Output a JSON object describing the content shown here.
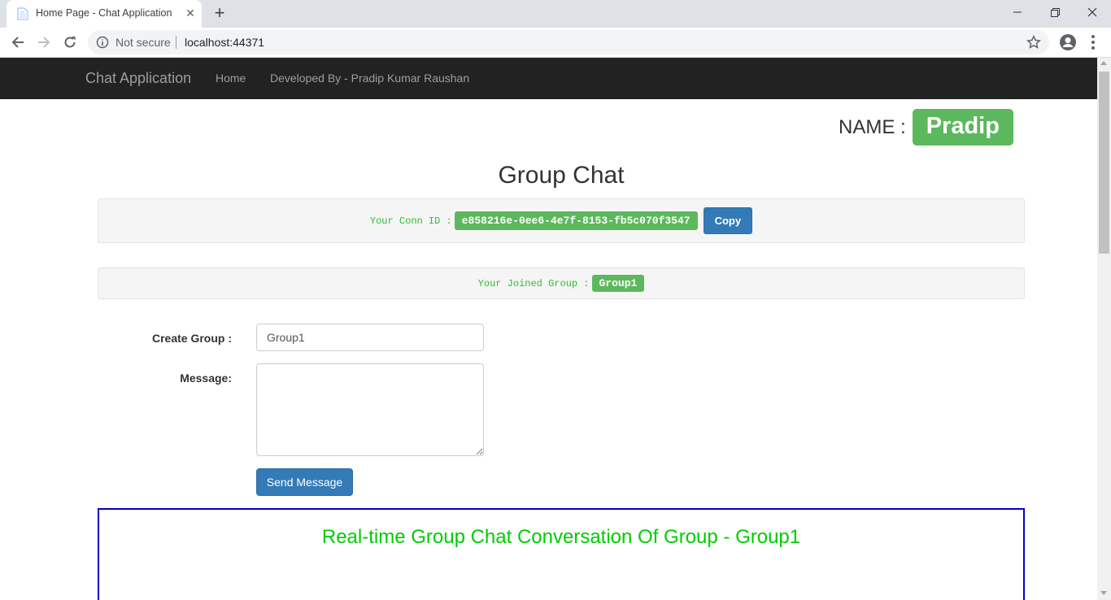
{
  "browser": {
    "tab_title": "Home Page - Chat Application",
    "security_label": "Not secure",
    "url": "localhost:44371"
  },
  "navbar": {
    "brand": "Chat Application",
    "links": [
      "Home",
      "Developed By - Pradip Kumar Raushan"
    ]
  },
  "user": {
    "name_label": "NAME :",
    "name": "Pradip"
  },
  "page": {
    "title": "Group Chat"
  },
  "connection": {
    "label": "Your Conn ID :",
    "id": "e858216e-0ee6-4e7f-8153-fb5c070f3547",
    "copy_label": "Copy"
  },
  "group": {
    "label": "Your Joined Group :",
    "name": "Group1"
  },
  "form": {
    "create_group_label": "Create Group :",
    "create_group_value": "Group1",
    "message_label": "Message:",
    "message_value": "",
    "send_label": "Send Message"
  },
  "conversation": {
    "title": "Real-time Group Chat Conversation Of Group - Group1"
  },
  "colors": {
    "navbar_bg": "#222222",
    "badge_green": "#5cb85c",
    "label_green": "#2ebd2e",
    "primary_blue": "#337ab7",
    "conversation_border": "#0000cc",
    "conversation_title": "#00cc00"
  }
}
